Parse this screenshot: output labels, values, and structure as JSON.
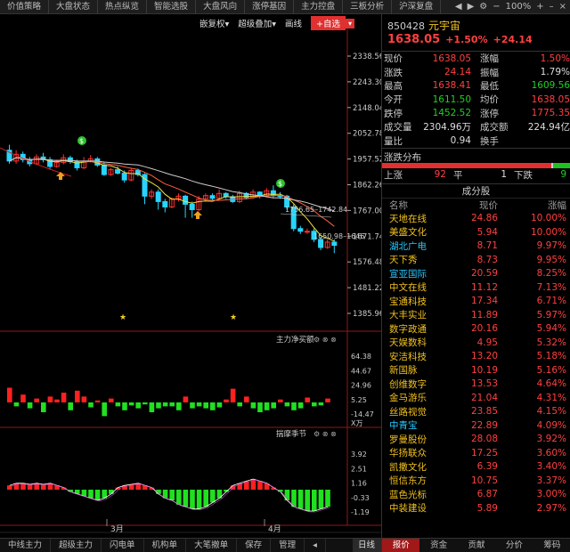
{
  "nav": {
    "tabs": [
      "价值策略",
      "大盘状态",
      "热点纵览",
      "智能选股",
      "大盘风向",
      "涨停基因",
      "主力控盘",
      "三板分析",
      "沪深复盘"
    ],
    "zoom": "100%",
    "minimize": "–",
    "close": "×"
  },
  "toolbar": {
    "btn1": "嵌复权▾",
    "btn2": "超级叠加▾",
    "btn3": "画线",
    "add": "+自选",
    "dd": "▾"
  },
  "price_axis": [
    "2338.56",
    "2243.30",
    "2148.04",
    "2052.78",
    "1957.52",
    "1862.26",
    "1767.00",
    "1671.74",
    "1576.48",
    "1481.22",
    "1385.96"
  ],
  "annot": {
    "range1": "1756.65–1742.84",
    "range2": "1650.98–1646"
  },
  "ind1": {
    "title": "主力净买额",
    "axis": [
      "64.38",
      "44.67",
      "24.96",
      "5.25",
      "-14.47"
    ],
    "unit": "X万"
  },
  "ind2": {
    "title": "揣摩季节",
    "axis": [
      "3.92",
      "2.51",
      "1.16",
      "-0.33",
      "-1.19"
    ]
  },
  "months": [
    "3月",
    "4月"
  ],
  "bottom": {
    "tabs": [
      "中线主力",
      "超级主力",
      "闪电单",
      "机构单",
      "大笔撤单",
      "保存",
      "管理"
    ],
    "period": "日线"
  },
  "stock": {
    "code": "850428",
    "name": "元宇宙",
    "price": "1638.05",
    "pct": "+1.50%",
    "chg": "+24.14"
  },
  "quote": [
    {
      "l": "现价",
      "v": "1638.05",
      "vc": "red",
      "l2": "涨幅",
      "v2": "1.50%",
      "v2c": "red"
    },
    {
      "l": "涨跌",
      "v": "24.14",
      "vc": "red",
      "l2": "振幅",
      "v2": "1.79%",
      "v2c": "white"
    },
    {
      "l": "最高",
      "v": "1638.41",
      "vc": "red",
      "l2": "最低",
      "v2": "1609.56",
      "v2c": "green"
    },
    {
      "l": "今开",
      "v": "1611.50",
      "vc": "green",
      "l2": "均价",
      "v2": "1638.05",
      "v2c": "red"
    },
    {
      "l": "跌停",
      "v": "1452.52",
      "vc": "green",
      "l2": "涨停",
      "v2": "1775.35",
      "v2c": "red"
    },
    {
      "l": "成交量",
      "v": "2304.96万",
      "vc": "white",
      "l2": "成交额",
      "v2": "224.94亿",
      "v2c": "white"
    },
    {
      "l": "量比",
      "v": "0.94",
      "vc": "white",
      "l2": "换手",
      "v2": "",
      "v2c": "white"
    }
  ],
  "dist": {
    "title": "涨跌分布",
    "up_label": "上涨",
    "up": "92",
    "flat_label": "平",
    "flat": "1",
    "down_label": "下跌",
    "down": "9",
    "up_frac": 0.9,
    "flat_frac": 0.01,
    "down_frac": 0.09
  },
  "constituents": {
    "title": "成分股",
    "cols": [
      "名称",
      "现价",
      "涨幅"
    ],
    "rows": [
      {
        "n": "天地在线",
        "nc": "yel",
        "p": "24.86",
        "c": "10.00%"
      },
      {
        "n": "美盛文化",
        "nc": "yel",
        "p": "5.94",
        "c": "10.00%"
      },
      {
        "n": "湖北广电",
        "nc": "cyan",
        "p": "8.71",
        "c": "9.97%"
      },
      {
        "n": "天下秀",
        "nc": "yel",
        "p": "8.73",
        "c": "9.95%"
      },
      {
        "n": "宣亚国际",
        "nc": "cyan",
        "p": "20.59",
        "c": "8.25%"
      },
      {
        "n": "中文在线",
        "nc": "yel",
        "p": "11.12",
        "c": "7.13%"
      },
      {
        "n": "宝通科技",
        "nc": "yel",
        "p": "17.34",
        "c": "6.71%"
      },
      {
        "n": "大丰实业",
        "nc": "yel",
        "p": "11.89",
        "c": "5.97%"
      },
      {
        "n": "数字政通",
        "nc": "yel",
        "p": "20.16",
        "c": "5.94%"
      },
      {
        "n": "天娱数科",
        "nc": "yel",
        "p": "4.95",
        "c": "5.32%"
      },
      {
        "n": "安洁科技",
        "nc": "yel",
        "p": "13.20",
        "c": "5.18%"
      },
      {
        "n": "新国脉",
        "nc": "yel",
        "p": "10.19",
        "c": "5.16%"
      },
      {
        "n": "创维数字",
        "nc": "yel",
        "p": "13.53",
        "c": "4.64%"
      },
      {
        "n": "金马游乐",
        "nc": "yel",
        "p": "21.04",
        "c": "4.31%"
      },
      {
        "n": "丝路视觉",
        "nc": "yel",
        "p": "23.85",
        "c": "4.15%"
      },
      {
        "n": "中青宝",
        "nc": "cyan",
        "p": "22.89",
        "c": "4.09%"
      },
      {
        "n": "罗曼股份",
        "nc": "yel",
        "p": "28.08",
        "c": "3.92%"
      },
      {
        "n": "华扬联众",
        "nc": "yel",
        "p": "17.25",
        "c": "3.60%"
      },
      {
        "n": "凯撒文化",
        "nc": "yel",
        "p": "6.39",
        "c": "3.40%"
      },
      {
        "n": "恒信东方",
        "nc": "yel",
        "p": "10.75",
        "c": "3.37%"
      },
      {
        "n": "蓝色光标",
        "nc": "yel",
        "p": "6.87",
        "c": "3.00%"
      },
      {
        "n": "中装建设",
        "nc": "yel",
        "p": "5.89",
        "c": "2.97%"
      }
    ]
  },
  "rtabs": [
    "报价",
    "资金",
    "贡献",
    "分价",
    "筹码"
  ]
}
